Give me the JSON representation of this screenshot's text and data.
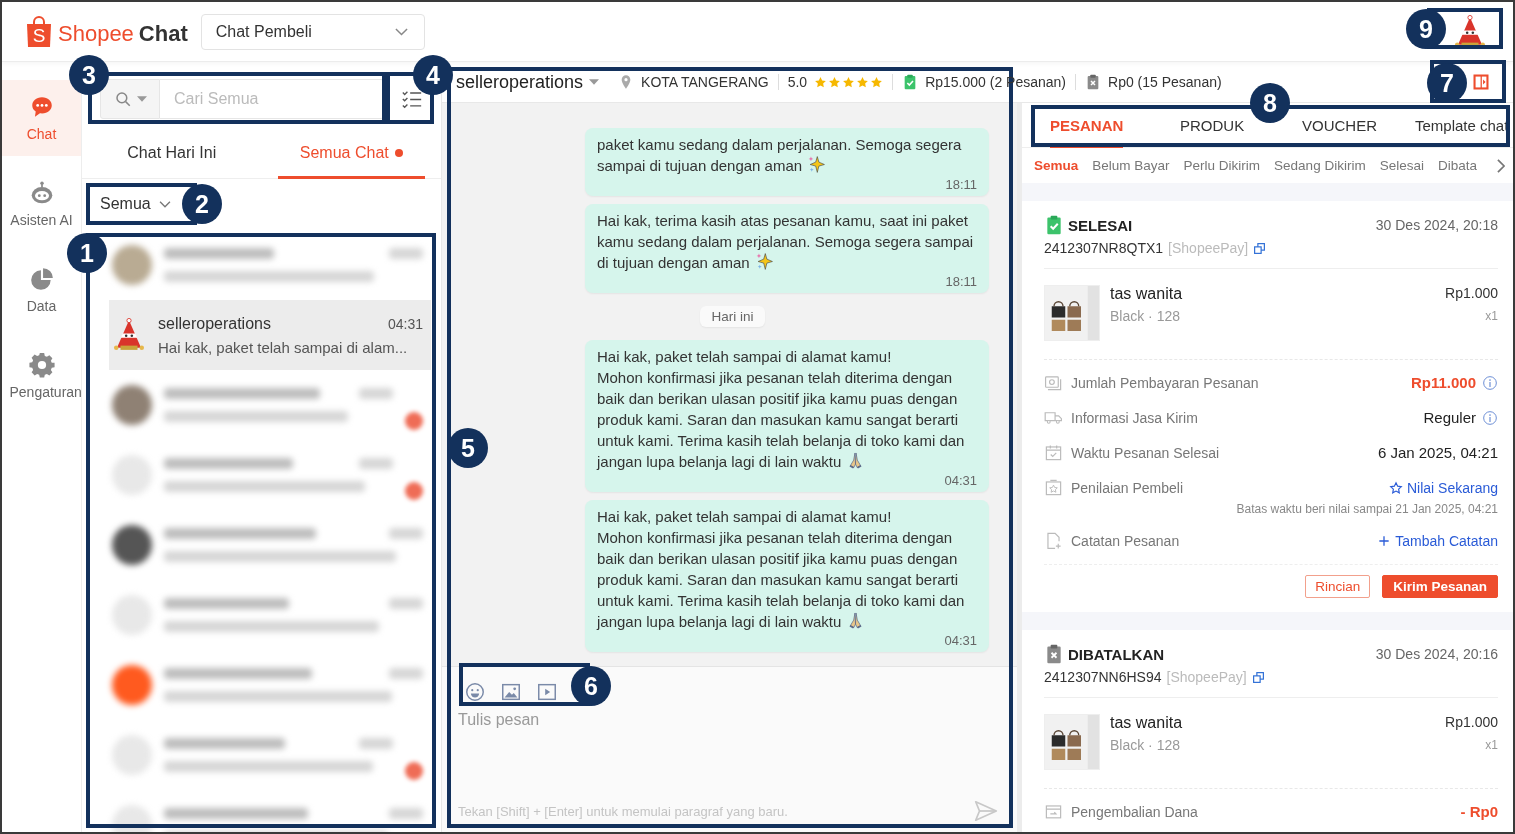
{
  "header": {
    "logo_mark": "S",
    "logo_brand": "Shopee",
    "logo_product": "Chat",
    "mode_select": "Chat Pembeli"
  },
  "sidebar": {
    "items": [
      {
        "kind": "chat",
        "label": "Chat",
        "selected": true
      },
      {
        "kind": "assistant",
        "label": "Asisten AI",
        "selected": false
      },
      {
        "kind": "data",
        "label": "Data",
        "selected": false
      },
      {
        "kind": "settings",
        "label": "Pengaturan",
        "selected": false
      }
    ]
  },
  "chat_list": {
    "search": {
      "placeholder": "Cari Semua"
    },
    "tabs": [
      {
        "label": "Chat Hari Ini",
        "selected": false,
        "dot": false
      },
      {
        "label": "Semua Chat",
        "selected": true,
        "dot": true
      }
    ],
    "filter": "Semua",
    "items": [
      {
        "kind": "blurred",
        "color": "#b9ab93",
        "unread": false,
        "selected": false
      },
      {
        "kind": "conversation",
        "name": "selleroperations",
        "time": "04:31",
        "preview": "Hai kak, paket telah sampai di alam...",
        "unread": false,
        "selected": true
      },
      {
        "kind": "blurred",
        "color": "#8f8174",
        "unread": true,
        "selected": false
      },
      {
        "kind": "blurred",
        "color": "#e8e8e8",
        "unread": true,
        "selected": false
      },
      {
        "kind": "blurred",
        "color": "#555555",
        "unread": false,
        "selected": false
      },
      {
        "kind": "blurred",
        "color": "#e8e8e8",
        "unread": false,
        "selected": false
      },
      {
        "kind": "blurred",
        "color": "#ff5a1f",
        "unread": false,
        "selected": false
      },
      {
        "kind": "blurred",
        "color": "#e8e8e8",
        "unread": true,
        "selected": false
      },
      {
        "kind": "blurred",
        "color": "#e8e8e8",
        "unread": false,
        "selected": false
      }
    ]
  },
  "chat_header": {
    "name": "selleroperations",
    "location": "KOTA TANGERANG",
    "rating": "5.0",
    "stars": 5,
    "stats": [
      {
        "kind": "paid",
        "text": "Rp15.000 (2 Pesanan)"
      },
      {
        "kind": "cancelled",
        "text": "Rp0 (15 Pesanan)"
      }
    ]
  },
  "messages": [
    {
      "kind": "bubble",
      "text": "paket kamu sedang dalam perjalanan. Semoga segera\nsampai di tujuan dengan aman",
      "emoji": {
        "kind": "sparkles"
      },
      "time": "18:11"
    },
    {
      "kind": "bubble",
      "text": "Hai kak, terima kasih atas pesanan kamu, saat ini paket kamu sedang dalam perjalanan. Semoga segera sampai di tujuan dengan aman",
      "emoji": {
        "kind": "sparkles"
      },
      "time": "18:11"
    },
    {
      "kind": "date",
      "text": "Hari ini"
    },
    {
      "kind": "bubble",
      "text": "Hai kak, paket telah sampai di alamat kamu!\nMohon konfirmasi jika pesanan telah diterima dengan baik dan berikan ulasan positif jika kamu puas dengan produk kami. Saran dan masukan kamu sangat berarti untuk kami. Terima kasih telah belanja di toko kami dan jangan lupa belanja lagi di lain waktu",
      "emoji": {
        "kind": "pray"
      },
      "time": "04:31"
    },
    {
      "kind": "bubble",
      "text": "Hai kak, paket telah sampai di alamat kamu!\nMohon konfirmasi jika pesanan telah diterima dengan baik dan berikan ulasan positif jika kamu puas dengan produk kami. Saran dan masukan kamu sangat berarti untuk kami. Terima kasih telah belanja di toko kami dan jangan lupa belanja lagi di lain waktu",
      "emoji": {
        "kind": "pray"
      },
      "time": "04:31"
    }
  ],
  "composer": {
    "placeholder": "Tulis pesan",
    "hint": "Tekan [Shift] + [Enter] untuk memulai paragraf yang baru."
  },
  "order_panel": {
    "tabs": [
      {
        "label": "PESANAN",
        "selected": true
      },
      {
        "label": "PRODUK",
        "selected": false
      },
      {
        "label": "VOUCHER",
        "selected": false
      },
      {
        "label": "Template chat",
        "selected": false
      }
    ],
    "status_tabs": [
      {
        "label": "Semua",
        "selected": true
      },
      {
        "label": "Belum Bayar",
        "selected": false
      },
      {
        "label": "Perlu Dikirim",
        "selected": false
      },
      {
        "label": "Sedang Dikirim",
        "selected": false
      },
      {
        "label": "Selesai",
        "selected": false
      },
      {
        "label": "Dibata",
        "selected": false
      }
    ],
    "orders": [
      {
        "kind": "completed",
        "status": "SELESAI",
        "date": "30 Des 2024, 20:18",
        "order_id": "2412307NR8QTX1",
        "payment": "[ShopeePay]",
        "product": {
          "name": "tas wanita",
          "variant": "Black · 128",
          "price": "Rp1.000",
          "quantity": "x1"
        },
        "details": [
          {
            "kind": "payment",
            "label": "Jumlah Pembayaran Pesanan",
            "value": "Rp11.000",
            "info": true
          },
          {
            "kind": "shipping",
            "label": "Informasi Jasa Kirim",
            "value": "Reguler",
            "info": true
          },
          {
            "kind": "time",
            "label": "Waktu Pesanan Selesai",
            "value": "6 Jan 2025, 04:21",
            "info": false
          },
          {
            "kind": "rating",
            "label": "Penilaian Pembeli",
            "value": "Nilai Sekarang",
            "info": false,
            "note": "Batas waktu beri nilai sampai 21 Jan 2025, 04:21"
          },
          {
            "kind": "note",
            "label": "Catatan Pesanan",
            "value": "Tambah Catatan",
            "info": false
          }
        ],
        "actions": [
          {
            "kind": "secondary",
            "label": "Rincian"
          },
          {
            "kind": "primary",
            "label": "Kirim Pesanan"
          }
        ]
      },
      {
        "kind": "cancelled",
        "status": "DIBATALKAN",
        "date": "30 Des 2024, 20:16",
        "order_id": "2412307NN6HS94",
        "payment": "[ShopeePay]",
        "product": {
          "name": "tas wanita",
          "variant": "Black · 128",
          "price": "Rp1.000",
          "quantity": "x1"
        },
        "details": [
          {
            "kind": "refund",
            "label": "Pengembalian Dana",
            "value": "- Rp0",
            "info": false
          }
        ]
      }
    ]
  },
  "annotations": [
    {
      "number": "1"
    },
    {
      "number": "2"
    },
    {
      "number": "3"
    },
    {
      "number": "4"
    },
    {
      "number": "5"
    },
    {
      "number": "6"
    },
    {
      "number": "7"
    },
    {
      "number": "8"
    },
    {
      "number": "9"
    }
  ]
}
